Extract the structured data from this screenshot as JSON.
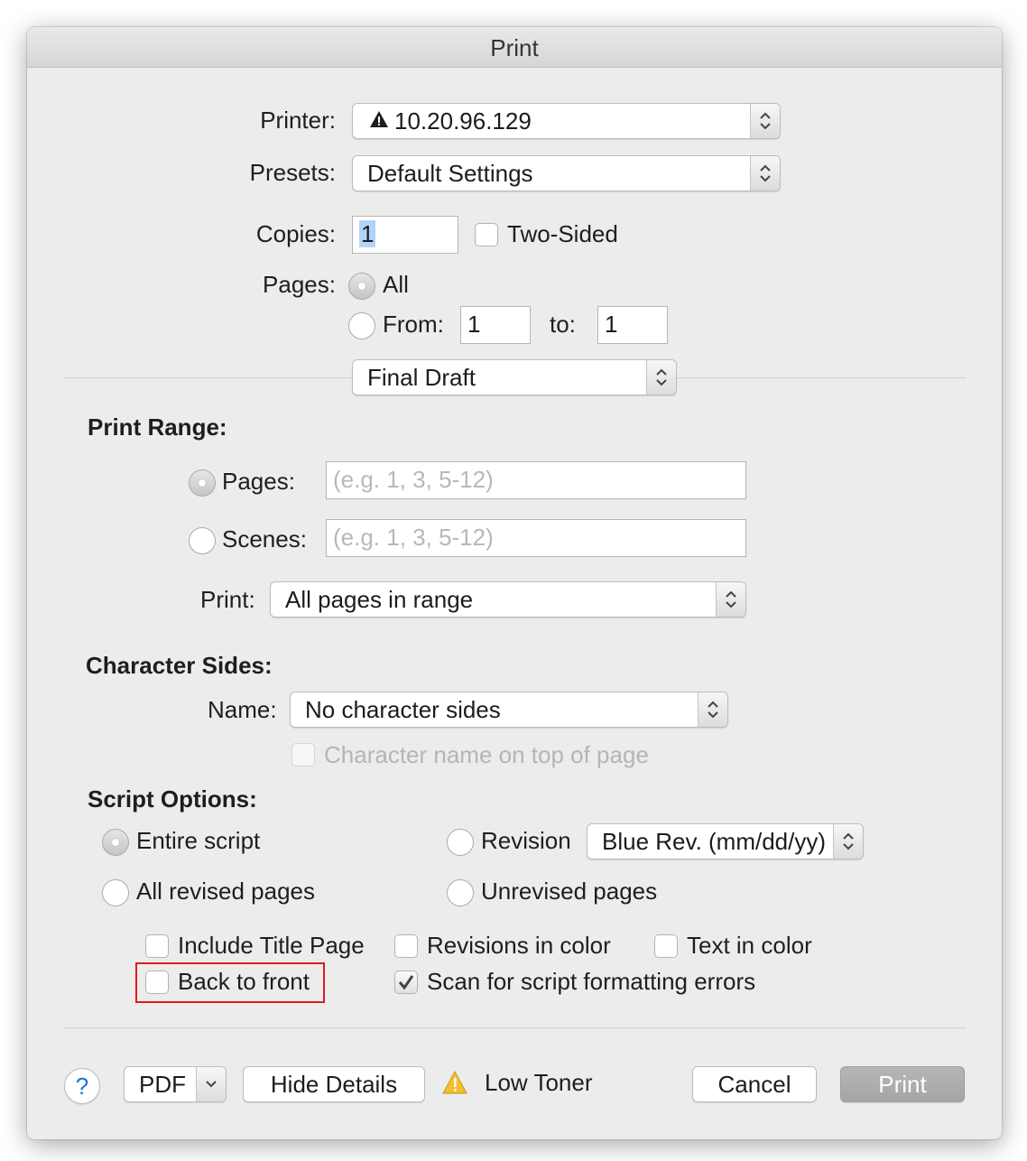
{
  "window": {
    "title": "Print"
  },
  "printer": {
    "label": "Printer:",
    "value": "10.20.96.129"
  },
  "presets": {
    "label": "Presets:",
    "value": "Default Settings"
  },
  "copies": {
    "label": "Copies:",
    "value": "1",
    "two_sided_label": "Two-Sided",
    "two_sided_checked": false
  },
  "pages": {
    "label": "Pages:",
    "all_label": "All",
    "from_label": "From:",
    "from_value": "1",
    "to_label": "to:",
    "to_value": "1",
    "selected": "All"
  },
  "section_popup": {
    "value": "Final Draft"
  },
  "print_range": {
    "heading": "Print Range:",
    "pages_label": "Pages:",
    "pages_placeholder": "(e.g. 1, 3, 5-12)",
    "scenes_label": "Scenes:",
    "scenes_placeholder": "(e.g. 1, 3, 5-12)",
    "selected": "Pages",
    "print_label": "Print:",
    "print_value": "All pages in range"
  },
  "character_sides": {
    "heading": "Character Sides:",
    "name_label": "Name:",
    "name_value": "No character sides",
    "top_of_page_label": "Character name on top of page",
    "top_of_page_enabled": false
  },
  "script_options": {
    "heading": "Script Options:",
    "entire_script": "Entire script",
    "all_revised_pages": "All revised pages",
    "revision": "Revision",
    "revision_value": "Blue Rev. (mm/dd/yy)",
    "unrevised_pages": "Unrevised pages",
    "selected": "Entire script",
    "include_title_page": "Include Title Page",
    "revisions_in_color": "Revisions in color",
    "text_in_color": "Text in color",
    "back_to_front": "Back to front",
    "scan_errors": "Scan for script formatting errors",
    "scan_errors_checked": true
  },
  "footer": {
    "help": "?",
    "pdf": "PDF",
    "hide_details": "Hide Details",
    "low_toner": "Low Toner",
    "cancel": "Cancel",
    "print": "Print"
  },
  "colors": {
    "highlight": "#e0191e",
    "default_button": "#adadad",
    "warning": "#f2c02f"
  },
  "icons": [
    "warning-icon",
    "stepper-icon",
    "chevron-down-icon",
    "checkmark-icon",
    "help-icon"
  ]
}
